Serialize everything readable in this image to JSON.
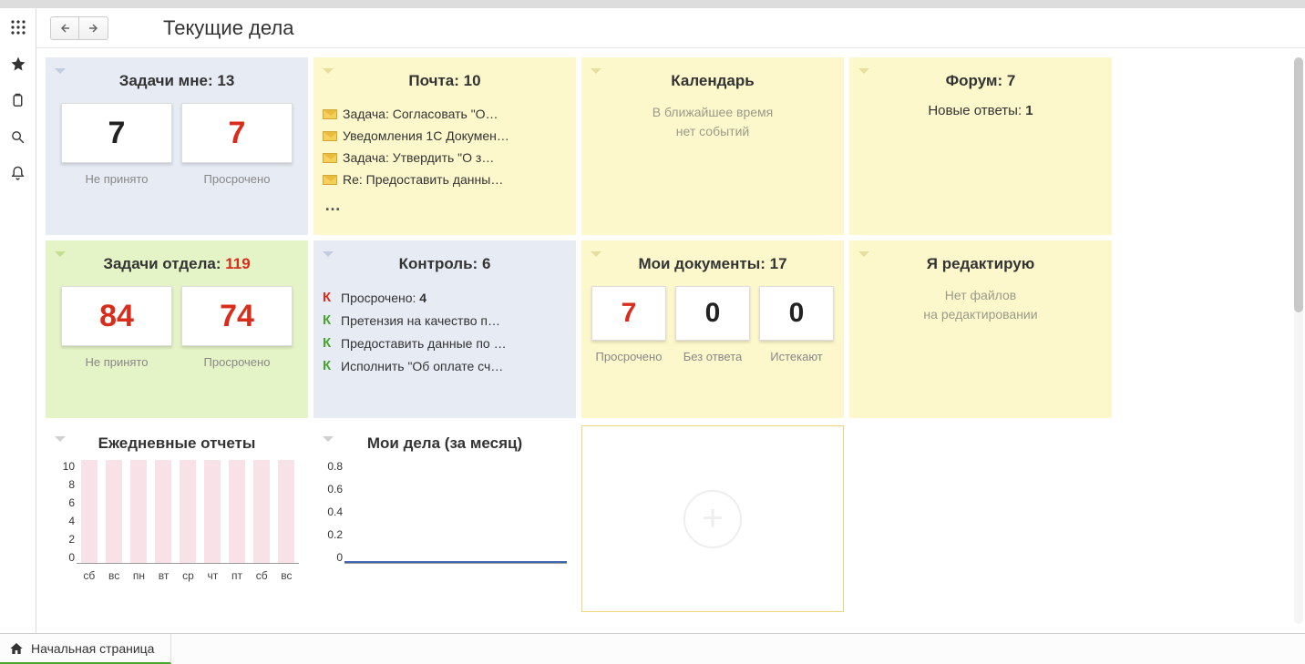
{
  "header": {
    "title": "Текущие дела"
  },
  "bottom_tab": {
    "label": "Начальная страница"
  },
  "widgets": {
    "tasks_mine": {
      "title_prefix": "Задачи мне: ",
      "count": "13",
      "tile1_value": "7",
      "tile1_label": "Не принято",
      "tile2_value": "7",
      "tile2_label": "Просрочено"
    },
    "mail": {
      "title_prefix": "Почта: ",
      "count": "10",
      "items": [
        "Задача: Согласовать \"О…",
        "Уведомления 1С Докумен…",
        "Задача: Утвердить \"О з…",
        "Re: Предоставить данны…"
      ],
      "more": "…"
    },
    "calendar": {
      "title": "Календарь",
      "empty_line1": "В ближайшее время",
      "empty_line2": "нет событий"
    },
    "forum": {
      "title_prefix": "Форум: ",
      "count": "7",
      "line_prefix": "Новые ответы: ",
      "line_count": "1"
    },
    "tasks_dept": {
      "title_prefix": "Задачи отдела: ",
      "count": "119",
      "tile1_value": "84",
      "tile1_label": "Не принято",
      "tile2_value": "74",
      "tile2_label": "Просрочено"
    },
    "control": {
      "title_prefix": "Контроль: ",
      "count": "6",
      "items": [
        {
          "k": "red",
          "text_prefix": "Просрочено: ",
          "bold": "4"
        },
        {
          "k": "green",
          "text": "Претензия на качество п…"
        },
        {
          "k": "green",
          "text": "Предоставить данные по …"
        },
        {
          "k": "green",
          "text": "Исполнить \"Об оплате сч…"
        }
      ]
    },
    "my_docs": {
      "title_prefix": "Мои документы: ",
      "count": "17",
      "tile1_value": "7",
      "tile1_label": "Просрочено",
      "tile2_value": "0",
      "tile2_label": "Без ответа",
      "tile3_value": "0",
      "tile3_label": "Истекают"
    },
    "editing": {
      "title": "Я редактирую",
      "empty_line1": "Нет файлов",
      "empty_line2": "на редактировании"
    }
  },
  "charts": {
    "daily": {
      "title": "Ежедневные отчеты"
    },
    "monthly": {
      "title": "Мои дела (за месяц)"
    }
  },
  "chart_data": [
    {
      "type": "bar",
      "title": "Ежедневные отчеты",
      "categories": [
        "сб",
        "вс",
        "пн",
        "вт",
        "ср",
        "чт",
        "пт",
        "сб",
        "вс"
      ],
      "values": [
        10,
        10,
        10,
        10,
        10,
        10,
        10,
        10,
        10
      ],
      "ylabel": "",
      "xlabel": "",
      "ylim": [
        0,
        10
      ],
      "yticks": [
        0,
        2,
        4,
        6,
        8,
        10
      ]
    },
    {
      "type": "line",
      "title": "Мои дела (за месяц)",
      "x": [
        0,
        1
      ],
      "values": [
        0,
        0
      ],
      "ylabel": "",
      "xlabel": "",
      "ylim": [
        0,
        0.8
      ],
      "yticks": [
        0,
        0.2,
        0.4,
        0.6,
        0.8
      ]
    }
  ]
}
